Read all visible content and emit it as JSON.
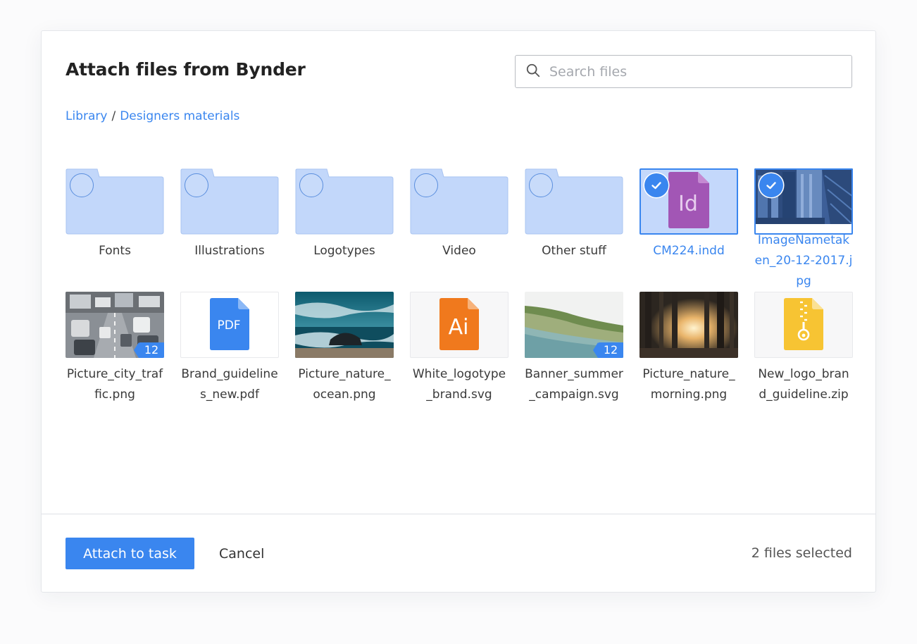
{
  "dialog": {
    "title": "Attach files from Bynder",
    "search": {
      "placeholder": "Search files",
      "value": ""
    },
    "breadcrumb": [
      {
        "label": "Library"
      },
      {
        "label": "Designers materials"
      }
    ],
    "breadcrumb_separator": "/"
  },
  "folders": [
    {
      "label": "Fonts",
      "selected": false
    },
    {
      "label": "Illustrations",
      "selected": false
    },
    {
      "label": "Logotypes",
      "selected": false
    },
    {
      "label": "Video",
      "selected": false
    },
    {
      "label": "Other stuff",
      "selected": false
    }
  ],
  "files": [
    {
      "label": "CM224.indd",
      "icon": "indesign-file-icon",
      "selected": true
    },
    {
      "label": "ImageNametaken_20-12-2017.jpg",
      "icon": "photo-thumbnail",
      "selected": true
    },
    {
      "label": "Picture_city_traffic.png",
      "icon": "photo-thumbnail",
      "badge": "12"
    },
    {
      "label": "Brand_guidelines_new.pdf",
      "icon": "pdf-file-icon",
      "icon_text": "PDF"
    },
    {
      "label": "Picture_nature_ocean.png",
      "icon": "photo-thumbnail"
    },
    {
      "label": "White_logotype_brand.svg",
      "icon": "illustrator-file-icon",
      "icon_text": "Ai"
    },
    {
      "label": "Banner_summer_campaign.svg",
      "icon": "photo-thumbnail",
      "badge": "12"
    },
    {
      "label": "Picture_nature_morning.png",
      "icon": "photo-thumbnail"
    },
    {
      "label": "New_logo_brand_guideline.zip",
      "icon": "zip-file-icon"
    }
  ],
  "file_icon_texts": {
    "indesign": "Id"
  },
  "footer": {
    "attach_label": "Attach to task",
    "cancel_label": "Cancel",
    "status": "2 files selected"
  },
  "colors": {
    "accent": "#3a86ef",
    "folder": "#c2d7fa",
    "indesign": "#a256b5",
    "illustrator": "#f0791d",
    "pdf": "#3a86ef",
    "zip": "#f7c433"
  }
}
